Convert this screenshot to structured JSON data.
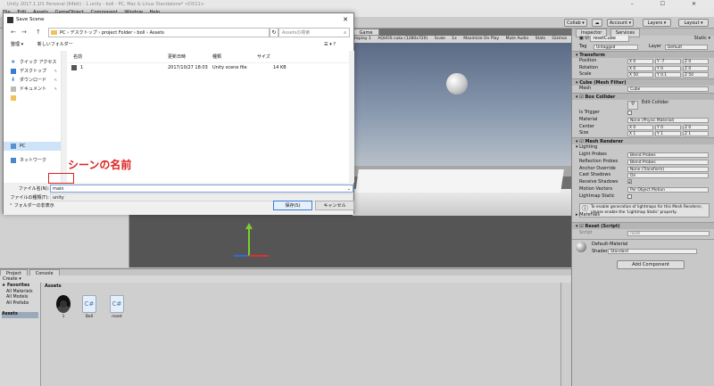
{
  "unity": {
    "window_title": "Unity 2017.1.1f1 Personal (64bit) - 1.unity - boll - PC, Mac & Linux Standalone* <DX11>",
    "window_controls": "–  ☐  ✕",
    "menu": [
      "File",
      "Edit",
      "Assets",
      "GameObject",
      "Component",
      "Window",
      "Help"
    ],
    "toolbar": {
      "collab": "Collab ▾",
      "account": "Account ▾",
      "layers": "Layers ▾",
      "layout": "Layout ▾"
    },
    "scene": {
      "tab_game": "Game",
      "game_bar": [
        "Display 1",
        "AQUOS cuku (1280x720)",
        "Scale",
        "1x",
        "Maximize On Play",
        "Mute Audio",
        "Stats",
        "Gizmos"
      ]
    },
    "project": {
      "tab_project": "Project",
      "tab_console": "Console",
      "create": "Create ▾",
      "favorites_label": "Favorites",
      "favorites": [
        "All Materials",
        "All Models",
        "All Prefabs"
      ],
      "assets_root": "Assets",
      "assets_header": "Assets",
      "assets": [
        {
          "name": "1",
          "kind": "unity"
        },
        {
          "name": "Ball",
          "kind": "script"
        },
        {
          "name": "reset",
          "kind": "script"
        }
      ]
    },
    "inspector": {
      "tab_inspector": "Inspector",
      "tab_services": "Services",
      "object_name": "resetCube",
      "static_label": "Static ▾",
      "tag_label": "Tag",
      "tag_value": "Untagged",
      "layer_label": "Layer",
      "layer_value": "Default",
      "transform": {
        "header": "Transform",
        "position_label": "Position",
        "rotation_label": "Rotation",
        "scale_label": "Scale",
        "position": [
          "X 0",
          "Y -7",
          "Z 0"
        ],
        "rotation": [
          "X 0",
          "Y 0",
          "Z 0"
        ],
        "scale": [
          "X 50",
          "Y 0.1",
          "Z 50"
        ]
      },
      "mesh_filter": {
        "header": "Cube (Mesh Filter)",
        "label": "Mesh",
        "value": "Cube"
      },
      "box_collider": {
        "header": "Box Collider",
        "edit_collider": "Edit Collider",
        "is_trigger": "Is Trigger",
        "material_label": "Material",
        "material_value": "None (Physic Material)",
        "center_label": "Center",
        "center": [
          "X 0",
          "Y 0",
          "Z 0"
        ],
        "size_label": "Size",
        "size": [
          "X 1",
          "Y 1",
          "Z 1"
        ]
      },
      "mesh_renderer": {
        "header": "Mesh Renderer",
        "lighting": "Lighting",
        "light_probes_label": "Light Probes",
        "light_probes_value": "Blend Probes",
        "reflection_probes_label": "Reflection Probes",
        "reflection_probes_value": "Blend Probes",
        "anchor_override_label": "Anchor Override",
        "anchor_override_value": "None (Transform)",
        "cast_shadows_label": "Cast Shadows",
        "cast_shadows_value": "On",
        "receive_shadows_label": "Receive Shadows",
        "motion_vectors_label": "Motion Vectors",
        "motion_vectors_value": "Per Object Motion",
        "lightmap_static_label": "Lightmap Static",
        "hint": "To enable generation of lightmaps for this Mesh Renderer, please enable the 'Lightmap Static' property.",
        "materials": "Materials"
      },
      "reset_script": {
        "header": "Reset (Script)",
        "label": "Script",
        "value": "reset"
      },
      "material": {
        "name": "Default-Material",
        "shader_label": "Shader",
        "shader_value": "Standard"
      },
      "add_component": "Add Component"
    }
  },
  "dialog": {
    "title": "Save Scene",
    "close": "✕",
    "nav_back": "←",
    "nav_forward": "→",
    "nav_up": "↑",
    "address": "PC  ›  デスクトップ  ›  project Folder  ›  boll  ›  Assets",
    "refresh": "↻",
    "search_placeholder": "Assetsの検索",
    "organize": "整理 ▾",
    "new_folder": "新しいフォルダー",
    "view_controls": "☰ ▾   ?",
    "nav_items": [
      {
        "label": "クイック アクセス",
        "icon": "star"
      },
      {
        "label": "デスクトップ",
        "icon": "desktop"
      },
      {
        "label": "ダウンロード",
        "icon": "download"
      },
      {
        "label": "ドキュメント",
        "icon": "document"
      },
      {
        "label": "",
        "icon": "folder"
      },
      {
        "label": "PC",
        "icon": "pc"
      },
      {
        "label": "ネットワーク",
        "icon": "network"
      }
    ],
    "columns": {
      "name": "名前",
      "date": "更新日時",
      "type": "種類",
      "size": "サイズ"
    },
    "files": [
      {
        "name": "1",
        "date": "2017/10/27 18:03",
        "type": "Unity scene file",
        "size": "14 KB"
      }
    ],
    "filename_label": "ファイル名(N):",
    "filename_value": "main",
    "filetype_label": "ファイルの種類(T):",
    "filetype_value": "unity",
    "hide_folders": "フォルダーの非表示",
    "save_button": "保存(S)",
    "cancel_button": "キャンセル"
  },
  "annotation": {
    "text": "シーンの名前",
    "color": "#e02020"
  }
}
